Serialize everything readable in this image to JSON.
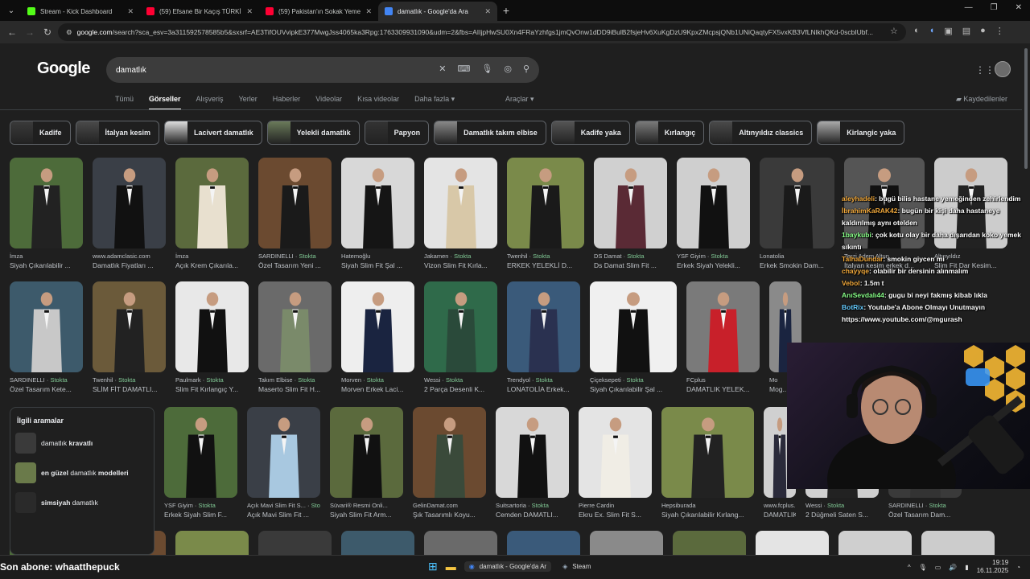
{
  "browser": {
    "tabs": [
      {
        "title": "Stream - Kick Dashboard",
        "color": "#53fc18"
      },
      {
        "title": "(59) Efsane Bir Kaçış TÜRKİYE'D",
        "color": "#ff0033"
      },
      {
        "title": "(59) Pakistan'ın Sokak Yemekle",
        "color": "#ff0033"
      },
      {
        "title": "damatlık - Google'da Ara",
        "color": "#4285f4"
      }
    ],
    "new_tab": "+",
    "url_host": "google.com",
    "url_rest": "/search?sca_esv=3a311592578585b5&sxsrf=AE3TifOUVvipkE377MwgJss4065ka3Rpg:1763309931090&udm=2&fbs=AIIjpHwSU0Xn4FRaYzhfgs1jmQvOnw1dDD9iBulB2fsjeHv6XuKgDzU9KpxZMcpsjQNb1UNiQaqtyFX5vxKB3VfLNlkhQKd-0scbIUbf..."
  },
  "google": {
    "logo": "Google",
    "query": "damatlık",
    "tabs": [
      "Tümü",
      "Görseller",
      "Alışveriş",
      "Yerler",
      "Haberler",
      "Videolar",
      "Kısa videolar",
      "Daha fazla ▾"
    ],
    "tools": "Araçlar ▾",
    "saved": "Kaydedilenler",
    "chips": [
      "Kadife",
      "İtalyan kesim",
      "Lacivert damatlık",
      "Yelekli damatlık",
      "Papyon",
      "Damatlık takım elbise",
      "Kadife yaka",
      "Kırlangıç",
      "Altınyıldız classics",
      "Kirlangic yaka"
    ],
    "row1": [
      {
        "src": "İmza",
        "stock": "",
        "cap": "Siyah Çıkarılabilir ..."
      },
      {
        "src": "www.adamclasic.com",
        "stock": "",
        "cap": "Damatlık Fiyatları ..."
      },
      {
        "src": "İmza",
        "stock": "",
        "cap": "Açık Krem Çıkarıla..."
      },
      {
        "src": "SARDINELLI",
        "stock": "Stokta",
        "cap": "Özel Tasarım Yeni ..."
      },
      {
        "src": "Hatemoğlu",
        "stock": "",
        "cap": "Siyah Slim Fit Şal ..."
      },
      {
        "src": "Jakamen",
        "stock": "Stokta",
        "cap": "Vizon Slim Fit Kırla..."
      },
      {
        "src": "Twenhil",
        "stock": "Stokta",
        "cap": "ERKEK YELEKLİ D..."
      },
      {
        "src": "DS Damat",
        "stock": "Stokta",
        "cap": "Ds Damat Slim Fit ..."
      },
      {
        "src": "YSF Giyim",
        "stock": "Stokta",
        "cap": "Erkek Siyah Yelekli..."
      },
      {
        "src": "Lonatolia",
        "stock": "",
        "cap": "Erkek Smokin Dam..."
      },
      {
        "src": "Terzi Adem Altun",
        "stock": "",
        "cap": "İtalyan kesim erkek d..."
      },
      {
        "src": "Altınyıldız",
        "stock": "",
        "cap": "Slim Fit Dar Kesim..."
      }
    ],
    "row2": [
      {
        "src": "SARDINELLI",
        "stock": "Stokta",
        "cap": "Özel Tasarım Kete..."
      },
      {
        "src": "Twenhil",
        "stock": "Stokta",
        "cap": "SLİM FİT DAMATLI..."
      },
      {
        "src": "Paulmark",
        "stock": "Stokta",
        "cap": "Slim Fit Kırlangıç Y..."
      },
      {
        "src": "Takım Elbise",
        "stock": "Stokta",
        "cap": "Maserto Slim Fit H..."
      },
      {
        "src": "Morven",
        "stock": "Stokta",
        "cap": "Morven Erkek Laci..."
      },
      {
        "src": "Wessi",
        "stock": "Stokta",
        "cap": "2 Parça Desenli K..."
      },
      {
        "src": "Trendyol",
        "stock": "Stokta",
        "cap": "LONATOLİA Erkek..."
      },
      {
        "src": "Çiçeksepeti",
        "stock": "Stokta",
        "cap": "Siyah Çıkarılabilir Şal ..."
      },
      {
        "src": "FCplus",
        "stock": "",
        "cap": "DAMATLIK YELEK..."
      },
      {
        "src": "Mo",
        "stock": "",
        "cap": "Mog..."
      }
    ],
    "related_title": "İlgili aramalar",
    "related": [
      {
        "pre": "damatlık ",
        "bold": "kravatlı",
        "after": ""
      },
      {
        "pre": "",
        "bold": "en güzel",
        "mid": " damatlık ",
        "after": "modelleri"
      },
      {
        "pre": "",
        "bold": "simsiyah",
        "mid": " damatlık",
        "after": ""
      }
    ],
    "row3": [
      {
        "src": "YSF Giyim",
        "stock": "Stokta",
        "cap": "Erkek Siyah Slim F..."
      },
      {
        "src": "Açık Mavi Slim Fit S...",
        "stock": "Stokta",
        "cap": "Açık Mavi Slim Fit ..."
      },
      {
        "src": "Süvari® Resmi Onli...",
        "stock": "",
        "cap": "Siyah Slim Fit Arm..."
      },
      {
        "src": "GelinDamat.com",
        "stock": "",
        "cap": "Şık Tasarımlı Koyu..."
      },
      {
        "src": "Suitsartoria",
        "stock": "Stokta",
        "cap": "Cemden DAMATLI..."
      },
      {
        "src": "Pierre Cardin",
        "stock": "",
        "cap": "Ekru Ex. Slim Fit S..."
      },
      {
        "src": "Hepsiburada",
        "stock": "",
        "cap": "Siyah Çıkarılabilir Kırlang..."
      },
      {
        "src": "www.fcplus.com",
        "stock": "",
        "cap": "DAMATLIK YELEK..."
      },
      {
        "src": "Wessi",
        "stock": "Stokta",
        "cap": "2 Düğmeli Saten S..."
      },
      {
        "src": "SARDINELLI",
        "stock": "Stokta",
        "cap": "Özel Tasarım Dam..."
      }
    ]
  },
  "chat": [
    {
      "user": "aleyhadeli",
      "msg": ": bugü bilis hastane yemeğinden zehirlendim",
      "c": ""
    },
    {
      "user": "İbrahimKaRAK42",
      "msg": ": bugün bir kişi daha hastaneye kaldırılmış aynı otelden",
      "c": ""
    },
    {
      "user": "1baykubi",
      "msg": ": çok kotu olay bir daha dışarıdan koko yemek sıkıntı",
      "c": "g"
    },
    {
      "user": "TalhaDundar",
      "msg": ": smokin giycen mi",
      "c": ""
    },
    {
      "user": "chayyqe",
      "msg": ": olabilir bir dersinin alınmalım",
      "c": ""
    },
    {
      "user": "Vebol",
      "msg": ": 1.5m t",
      "c": ""
    },
    {
      "user": "AnıSevdalı44",
      "msg": ": gugu bi neyi fakmış kibab lıkla",
      "c": "g"
    },
    {
      "user": "BotRix",
      "msg": ": Youtube'a Abone Olmayı Unutmayın https://www.youtube.com/@mgurash",
      "c": "b"
    }
  ],
  "taskbar": {
    "subscriber": "Son abone: whaatthepuck",
    "apps": [
      {
        "label": "damatlık - Google'da Ar",
        "active": true
      },
      {
        "label": "Steam",
        "active": false
      }
    ],
    "time": "19:19",
    "date": "16.11.2025"
  }
}
